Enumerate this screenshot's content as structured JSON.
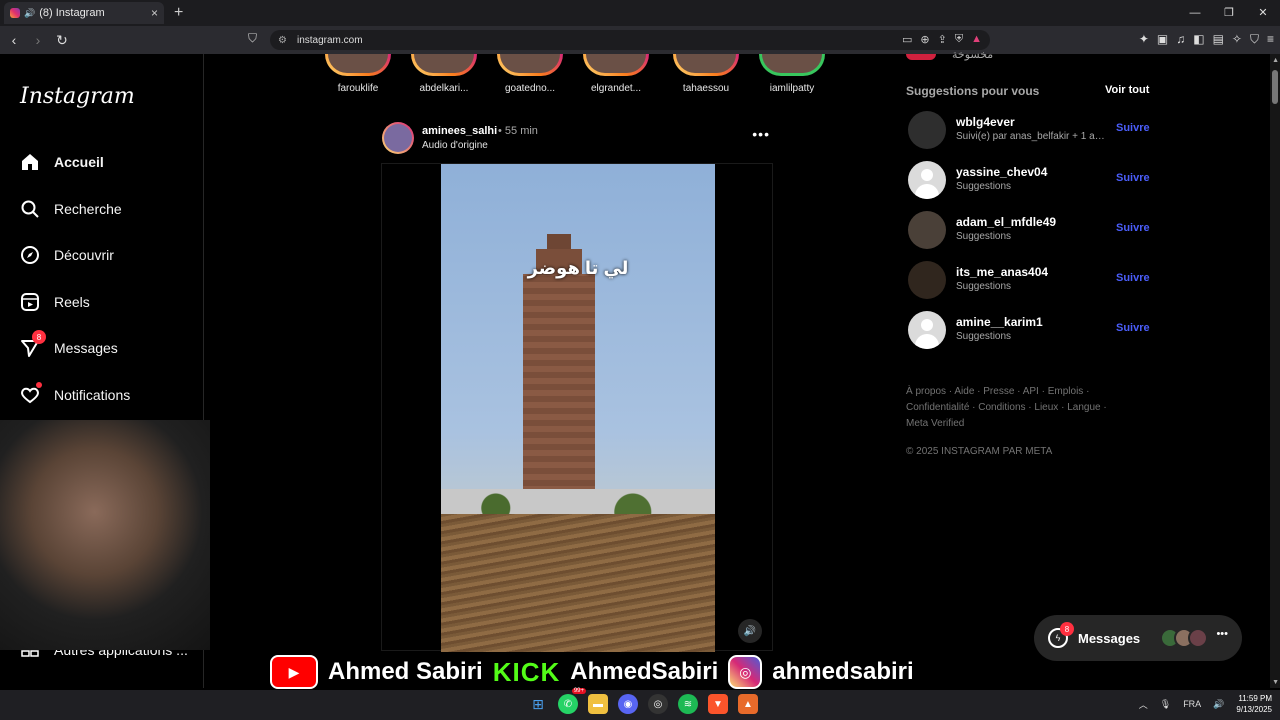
{
  "browser": {
    "tab_title": "(8) Instagram",
    "url": "instagram.com"
  },
  "sidebar": {
    "logo": "Instagram",
    "items": [
      {
        "label": "Accueil"
      },
      {
        "label": "Recherche"
      },
      {
        "label": "Découvrir"
      },
      {
        "label": "Reels"
      },
      {
        "label": "Messages",
        "badge": "8"
      },
      {
        "label": "Notifications"
      },
      {
        "label": "Autres applications ..."
      }
    ]
  },
  "stories": [
    {
      "name": "farouklife"
    },
    {
      "name": "abdelkari..."
    },
    {
      "name": "goatedno..."
    },
    {
      "name": "elgrandet..."
    },
    {
      "name": "tahaessou"
    },
    {
      "name": "iamlilpatty"
    }
  ],
  "post": {
    "username": "aminees_salhi",
    "time": "• 55 min",
    "audio": "Audio d'origine",
    "overlay_text": "لي تا هوضر"
  },
  "suggestions": {
    "partial_top": "مخسوخة",
    "title": "Suggestions pour vous",
    "see_all": "Voir tout",
    "follow_label": "Suivre",
    "items": [
      {
        "name": "wblg4ever",
        "sub": "Suivi(e) par anas_belfakir + 1 au..."
      },
      {
        "name": "yassine_chev04",
        "sub": "Suggestions"
      },
      {
        "name": "adam_el_mfdle49",
        "sub": "Suggestions"
      },
      {
        "name": "its_me_anas404",
        "sub": "Suggestions"
      },
      {
        "name": "amine__karim1",
        "sub": "Suggestions"
      }
    ]
  },
  "footer": {
    "links": "À propos · Aide · Presse · API · Emplois · Confidentialité · Conditions · Lieux · Langue · Meta Verified",
    "copyright": "© 2025 INSTAGRAM PAR META"
  },
  "messages_pill": {
    "label": "Messages",
    "badge": "8"
  },
  "stream_banner": {
    "youtube": "Ahmed Sabiri",
    "kick_logo": "KICK",
    "kick": "AhmedSabiri",
    "instagram": "ahmedsabiri"
  },
  "taskbar": {
    "badge": "99+",
    "lang": "FRA",
    "time": "11:59 PM",
    "date": "9/13/2025"
  }
}
